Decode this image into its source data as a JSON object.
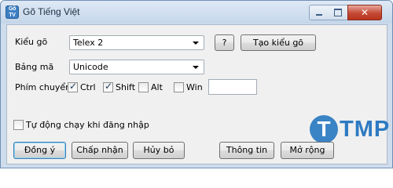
{
  "window": {
    "title": "Gõ Tiếng Việt",
    "icon_top": "Gõ",
    "icon_bottom": "TV",
    "close_glyph": "✕"
  },
  "form": {
    "kieu_go_label": "Kiểu gõ",
    "kieu_go_value": "Telex 2",
    "help_label": "?",
    "tao_kieu_go_label": "Tạo kiểu gõ",
    "bang_ma_label": "Bảng mã",
    "bang_ma_value": "Unicode",
    "phim_chuyen_label": "Phím chuyển",
    "ctrl_label": "Ctrl",
    "ctrl_checked": true,
    "shift_label": "Shift",
    "shift_checked": true,
    "alt_label": "Alt",
    "alt_checked": false,
    "win_label": "Win",
    "win_checked": false,
    "hotkey_value": "",
    "autostart_label": "Tự động chạy khi đăng nhập",
    "autostart_checked": false
  },
  "buttons": {
    "dong_y": "Đồng ý",
    "chap_nhan": "Chấp nhận",
    "huy_bo": "Hủy bỏ",
    "thong_tin": "Thông tin",
    "mo_rong": "Mở rộng"
  },
  "watermark": {
    "letter": "T",
    "text": "TMP"
  },
  "icons": {
    "app": "app-icon",
    "minimize": "minimize-icon",
    "maximize": "maximize-icon",
    "close": "close-icon",
    "dropdown": "chevron-down-icon",
    "check": "checkmark-icon"
  },
  "colors": {
    "title_bar": "#c5d6ea",
    "close_button": "#c44a34",
    "dialog_bg": "#f0f0f0",
    "default_button_border": "#3c7fb1",
    "watermark": "#3a83c5"
  }
}
